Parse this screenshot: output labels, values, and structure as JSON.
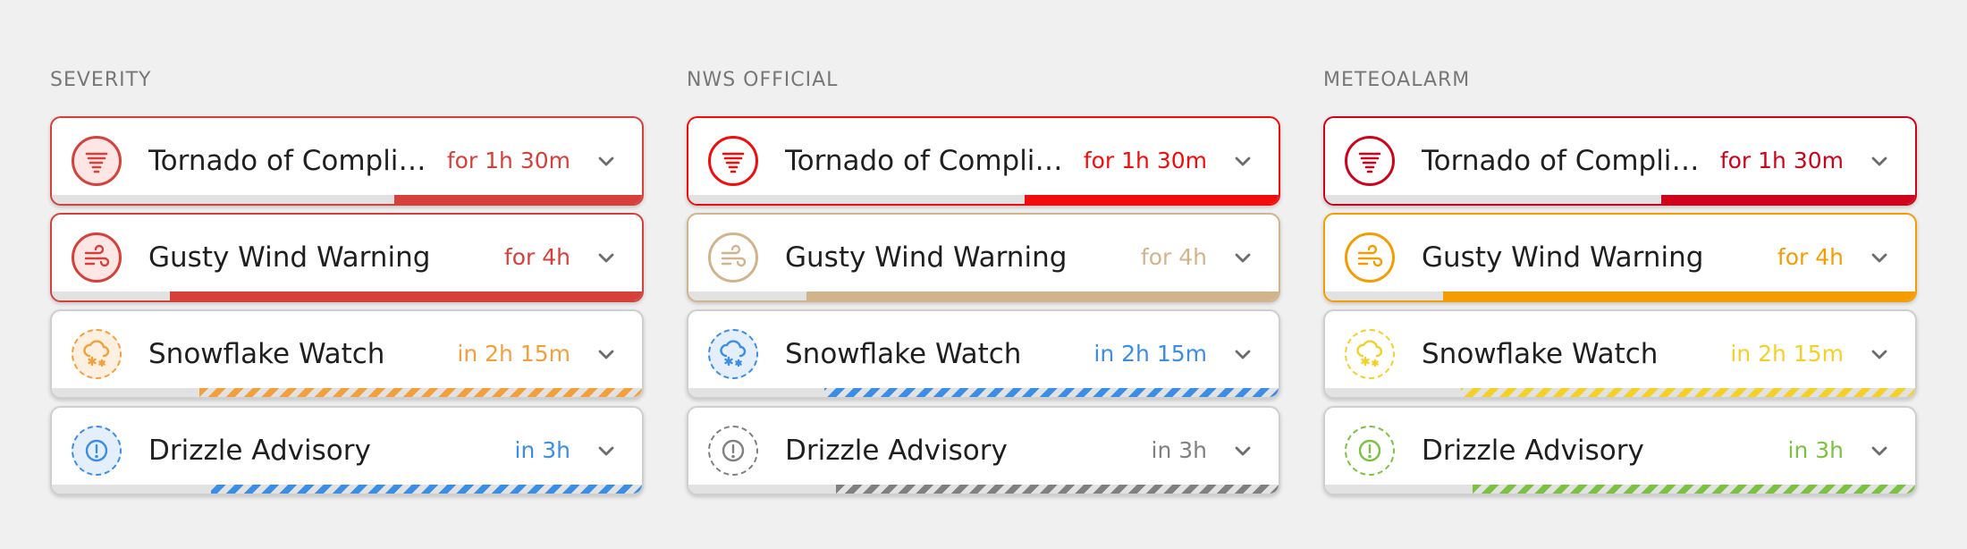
{
  "columns": [
    {
      "title": "SEVERITY",
      "alerts": [
        {
          "name": "Tornado of Complicated Conditions",
          "time": "for 1h 30m",
          "icon": "tornado-icon",
          "color": "#d6403a",
          "tint": "#fde6e4",
          "active": true,
          "progress": 0.42
        },
        {
          "name": "Gusty Wind Warning",
          "time": "for 4h",
          "icon": "wind-icon",
          "color": "#d6403a",
          "tint": "#fde6e4",
          "active": true,
          "progress": 0.8
        },
        {
          "name": "Snowflake Watch",
          "time": "in 2h 15m",
          "icon": "snowflake-icon",
          "color": "#f3a03c",
          "tint": "#fdf0e0",
          "active": false,
          "progress": 0.75
        },
        {
          "name": "Drizzle Advisory",
          "time": "in 3h",
          "icon": "exclamation-icon",
          "color": "#3b8ee6",
          "tint": "#e4effb",
          "active": false,
          "progress": 0.73
        }
      ]
    },
    {
      "title": "NWS OFFICIAL",
      "alerts": [
        {
          "name": "Tornado of Complicated Conditions",
          "time": "for 1h 30m",
          "icon": "tornado-icon",
          "color": "#f20c0c",
          "tint": "#fff",
          "active": true,
          "progress": 0.43
        },
        {
          "name": "Gusty Wind Warning",
          "time": "for 4h",
          "icon": "wind-icon",
          "color": "#d2b48c",
          "tint": "#fff",
          "active": true,
          "progress": 0.8
        },
        {
          "name": "Snowflake Watch",
          "time": "in 2h 15m",
          "icon": "snowflake-icon",
          "color": "#3b8ee6",
          "tint": "#e4effb",
          "active": false,
          "progress": 0.77
        },
        {
          "name": "Drizzle Advisory",
          "time": "in 3h",
          "icon": "exclamation-icon",
          "color": "#808080",
          "tint": "#fff",
          "active": false,
          "progress": 0.75
        }
      ]
    },
    {
      "title": "METEOALARM",
      "alerts": [
        {
          "name": "Tornado of Complicated Conditions",
          "time": "for 1h 30m",
          "icon": "tornado-icon",
          "color": "#d0021b",
          "tint": "#fff",
          "active": true,
          "progress": 0.43
        },
        {
          "name": "Gusty Wind Warning",
          "time": "for 4h",
          "icon": "wind-icon",
          "color": "#f59c00",
          "tint": "#fff",
          "active": true,
          "progress": 0.8
        },
        {
          "name": "Snowflake Watch",
          "time": "in 2h 15m",
          "icon": "snowflake-icon",
          "color": "#f5d027",
          "tint": "#fff",
          "active": false,
          "progress": 0.77
        },
        {
          "name": "Drizzle Advisory",
          "time": "in 3h",
          "icon": "exclamation-icon",
          "color": "#7cc242",
          "tint": "#fff",
          "active": false,
          "progress": 0.75
        }
      ]
    }
  ]
}
